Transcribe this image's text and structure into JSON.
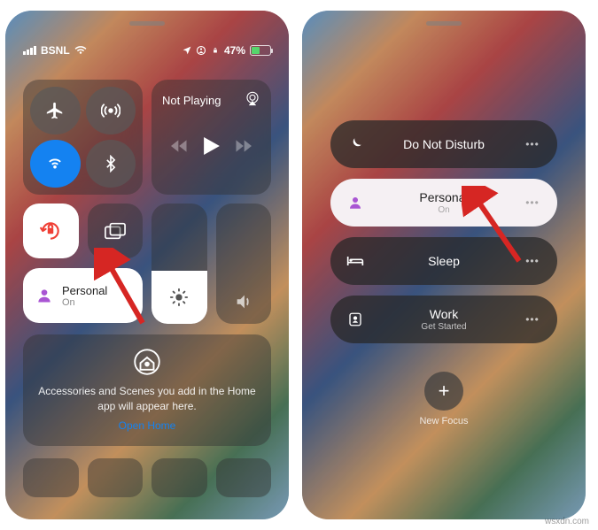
{
  "statusbar": {
    "carrier": "BSNL",
    "battery_pct": "47%"
  },
  "cc": {
    "music_title": "Not Playing",
    "personal_label": "Personal",
    "personal_status": "On",
    "home_hint": "Accessories and Scenes you add in the Home app will appear here.",
    "open_home": "Open Home"
  },
  "focus": {
    "dnd": "Do Not Disturb",
    "personal": "Personal",
    "personal_sub": "On",
    "sleep": "Sleep",
    "work": "Work",
    "work_sub": "Get Started",
    "new_focus": "New Focus"
  },
  "watermark": "wsxdn.com"
}
